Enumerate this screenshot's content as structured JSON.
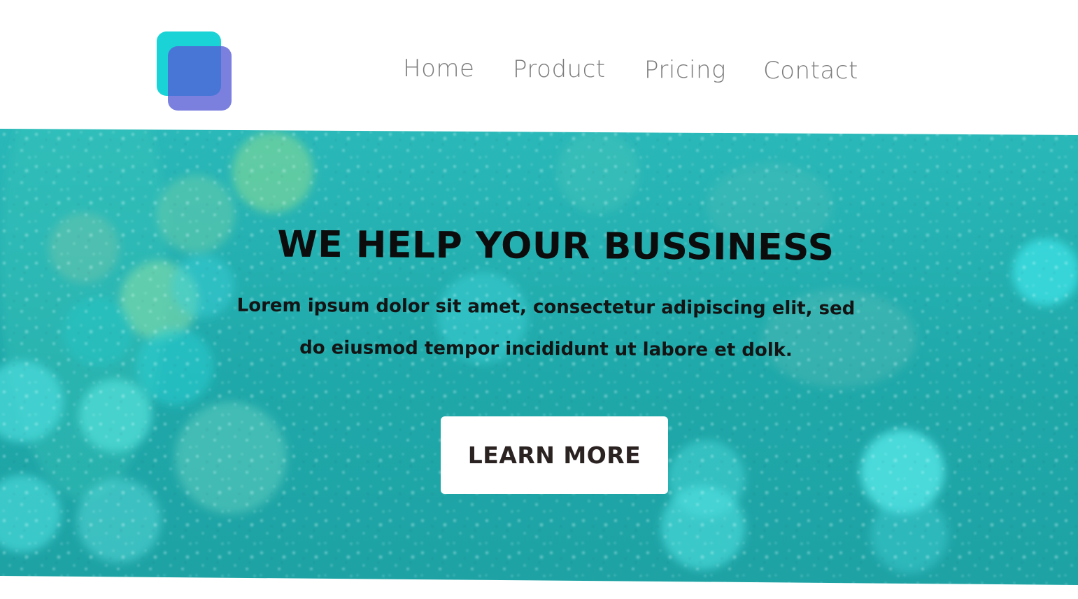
{
  "header": {
    "logo": {
      "name": "overlapping-squares-logo",
      "colors": {
        "back": "#1ad3d6",
        "front": "#5b5fd6"
      }
    },
    "nav": {
      "items": [
        {
          "label": "Home"
        },
        {
          "label": "Product"
        },
        {
          "label": "Pricing"
        },
        {
          "label": "Contact"
        }
      ]
    }
  },
  "hero": {
    "title": "WE HELP YOUR BUSSINESS",
    "text_line1": "Lorem ipsum dolor sit amet, consectetur adipiscing elit, sed",
    "text_line2": "do eiusmod tempor incididunt ut labore et dolk.",
    "cta_label": "LEARN MORE",
    "background_color": "#1fa8a9"
  }
}
